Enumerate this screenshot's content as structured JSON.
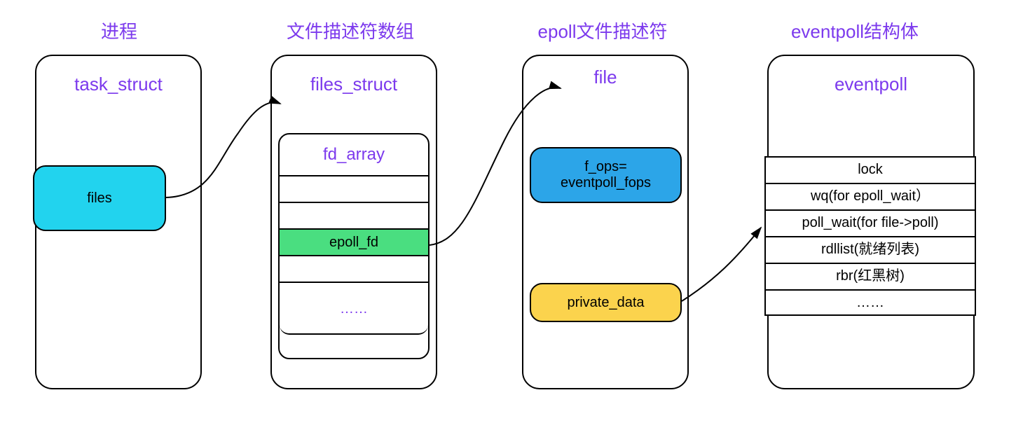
{
  "titles": {
    "process": "进程",
    "fd_array": "文件描述符数组",
    "epoll_fd": "epoll文件描述符",
    "eventpoll": "eventpoll结构体"
  },
  "col1": {
    "header": "task_struct",
    "files_field": "files"
  },
  "col2": {
    "header": "files_struct",
    "inner_header": "fd_array",
    "rows": [
      "",
      "",
      "epoll_fd",
      "",
      "……"
    ]
  },
  "col3": {
    "header": "file",
    "fops": "f_ops=\neventpoll_fops",
    "private_data": "private_data"
  },
  "col4": {
    "header": "eventpoll",
    "fields": [
      "lock",
      "wq(for epoll_wait）",
      "poll_wait(for file->poll)",
      "rdllist(就绪列表)",
      "rbr(红黑树)",
      "……"
    ]
  }
}
